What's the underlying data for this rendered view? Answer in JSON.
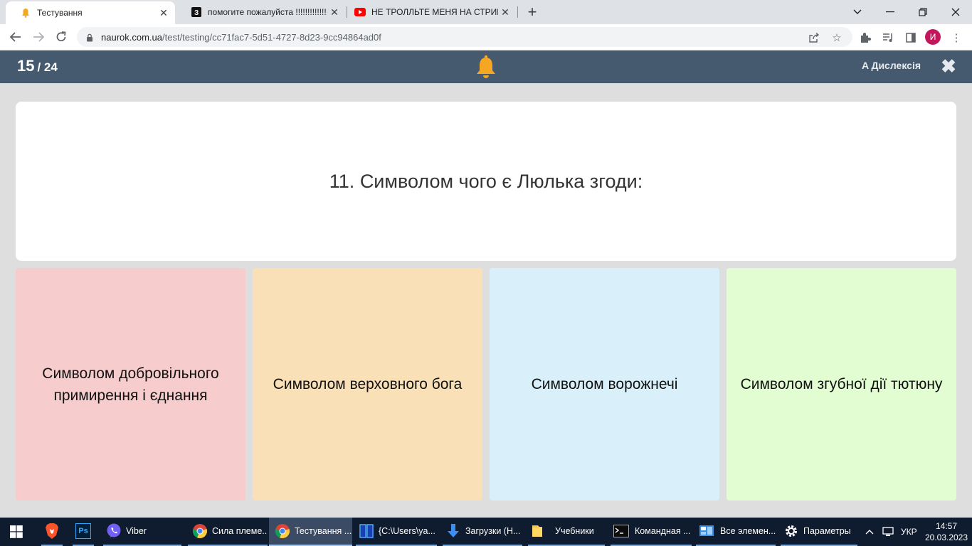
{
  "browser": {
    "tabs": [
      {
        "title": "Тестування",
        "favicon": "bell-favicon"
      },
      {
        "title": "помогите пожалуйста !!!!!!!!!!!!!!!",
        "favicon": "znanija-favicon"
      },
      {
        "title": "НЕ ТРОЛЛЬТЕ МЕНЯ НА СТРИМ",
        "favicon": "youtube-favicon"
      }
    ],
    "url_host": "naurok.com.ua",
    "url_path": "/test/testing/cc71fac7-5d51-4727-8d23-9cc94864ad0f",
    "profile_initial": "И"
  },
  "app": {
    "question_current": "15",
    "question_total": "/ 24",
    "dyslexia_label": "A Дислексія",
    "bell_color": "#f5a623",
    "header_color": "#455a6e"
  },
  "question": {
    "text": "11. Символом чого є Люлька згоди:"
  },
  "answers": [
    {
      "text": "Символом добровільного примирення і єднання",
      "color": "#f6cccc"
    },
    {
      "text": "Символом верховного бога",
      "color": "#fae0b6"
    },
    {
      "text": "Символом ворожнечі",
      "color": "#d9f0fa"
    },
    {
      "text": "Символом згубної дії тютюну",
      "color": "#e1fdd1"
    }
  ],
  "taskbar": {
    "items": [
      {
        "label": "",
        "icon": "brave-icon"
      },
      {
        "label": "",
        "icon": "photoshop-icon"
      },
      {
        "label": "Viber",
        "icon": "viber-icon"
      },
      {
        "label": "Сила племе...",
        "icon": "chrome-icon"
      },
      {
        "label": "Тестування ...",
        "icon": "chrome-icon"
      },
      {
        "label": "{C:\\Users\\ya...",
        "icon": "far-manager-icon"
      },
      {
        "label": "Загрузки (Н...",
        "icon": "download-icon"
      },
      {
        "label": "Учебники",
        "icon": "folder-icon"
      },
      {
        "label": "Командная ...",
        "icon": "cmd-icon"
      },
      {
        "label": "Все элемен...",
        "icon": "control-panel-icon"
      },
      {
        "label": "Параметры",
        "icon": "settings-icon"
      }
    ],
    "language": "УКР",
    "time": "14:57",
    "date": "20.03.2023"
  }
}
